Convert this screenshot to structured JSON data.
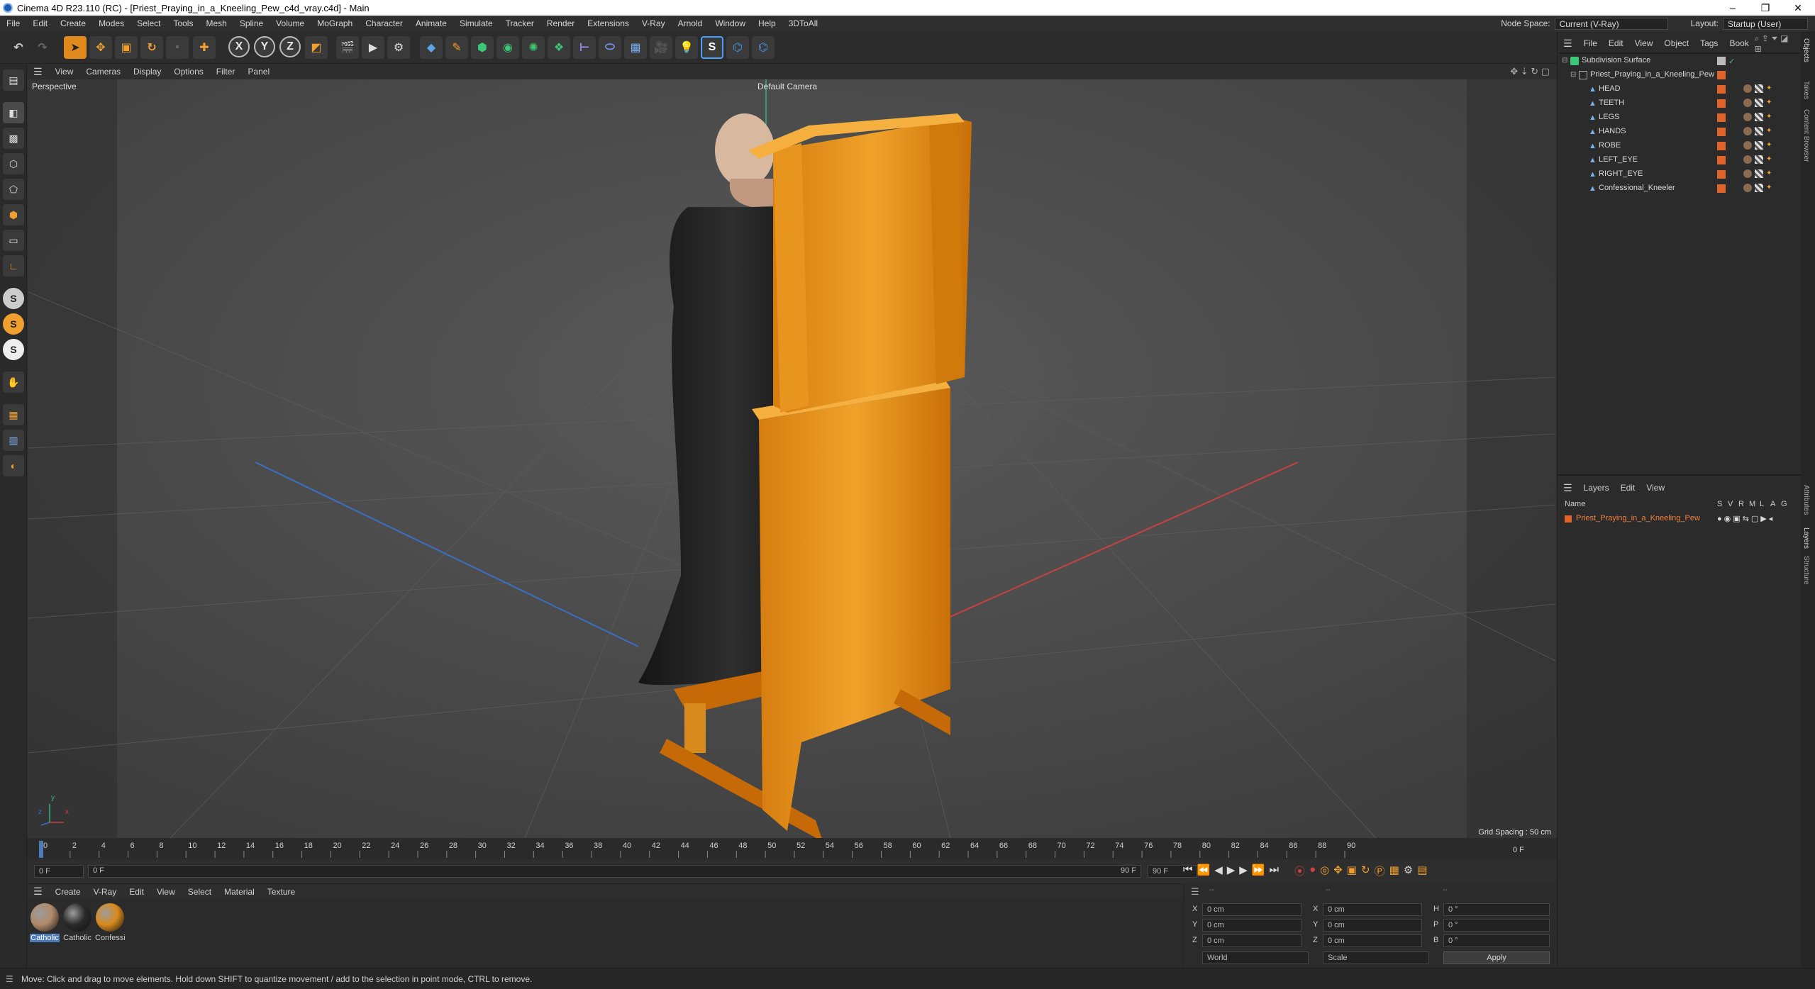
{
  "window": {
    "title": "Cinema 4D R23.110 (RC) - [Priest_Praying_in_a_Kneeling_Pew_c4d_vray.c4d] - Main",
    "controls": [
      "–",
      "❐",
      "✕"
    ]
  },
  "menubar": {
    "items": [
      "File",
      "Edit",
      "Create",
      "Modes",
      "Select",
      "Tools",
      "Mesh",
      "Spline",
      "Volume",
      "MoGraph",
      "Character",
      "Animate",
      "Simulate",
      "Tracker",
      "Render",
      "Extensions",
      "V-Ray",
      "Arnold",
      "Window",
      "Help",
      "3DToAll"
    ],
    "node_space_label": "Node Space:",
    "node_space_value": "Current (V-Ray)",
    "layout_label": "Layout:",
    "layout_value": "Startup (User)"
  },
  "toolbar": {
    "axis_x": "X",
    "axis_y": "Y",
    "axis_z": "Z"
  },
  "left_tools": {
    "s_labels": [
      "S",
      "S",
      "S"
    ]
  },
  "viewport": {
    "menu": [
      "View",
      "Cameras",
      "Display",
      "Options",
      "Filter",
      "Panel"
    ],
    "view_name": "Perspective",
    "camera_name": "Default Camera",
    "grid_spacing": "Grid Spacing : 50 cm",
    "axis_y": "y",
    "axis_z": "z",
    "axis_x": "x"
  },
  "timeline": {
    "ticks": [
      "0",
      "2",
      "4",
      "6",
      "8",
      "10",
      "12",
      "14",
      "16",
      "18",
      "20",
      "22",
      "24",
      "26",
      "28",
      "30",
      "32",
      "34",
      "36",
      "38",
      "40",
      "42",
      "44",
      "46",
      "48",
      "50",
      "52",
      "54",
      "56",
      "58",
      "60",
      "62",
      "64",
      "66",
      "68",
      "70",
      "72",
      "74",
      "76",
      "78",
      "80",
      "82",
      "84",
      "86",
      "88",
      "90"
    ],
    "start_frame": "0 F",
    "current_frame": "0 F",
    "end_frame": "90 F",
    "end_frame2": "90 F",
    "frame_right": "0 F"
  },
  "material_manager": {
    "menu": [
      "Create",
      "V-Ray",
      "Edit",
      "View",
      "Select",
      "Material",
      "Texture"
    ],
    "materials": [
      {
        "name": "Catholic",
        "color": "#b08a6a",
        "selected": true
      },
      {
        "name": "Catholic",
        "color": "#2a2a2a",
        "selected": false
      },
      {
        "name": "Confessi",
        "color": "#d98a1c",
        "selected": false
      }
    ]
  },
  "coordinates": {
    "header_left": "--",
    "header_mid": "--",
    "header_right": "--",
    "rows": [
      {
        "a": "X",
        "av": "0 cm",
        "b": "X",
        "bv": "0 cm",
        "c": "H",
        "cv": "0 °"
      },
      {
        "a": "Y",
        "av": "0 cm",
        "b": "Y",
        "bv": "0 cm",
        "c": "P",
        "cv": "0 °"
      },
      {
        "a": "Z",
        "av": "0 cm",
        "b": "Z",
        "bv": "0 cm",
        "c": "B",
        "cv": "0 °"
      }
    ],
    "space": "World",
    "mode": "Scale",
    "apply": "Apply"
  },
  "status": {
    "text": "Move: Click and drag to move elements. Hold down SHIFT to quantize movement / add to the selection in point mode, CTRL to remove."
  },
  "object_manager": {
    "menu": [
      "File",
      "Edit",
      "View",
      "Object",
      "Tags",
      "Book"
    ],
    "objects": [
      {
        "name": "Subdivision Surface",
        "indent": 0
      },
      {
        "name": "Priest_Praying_in_a_Kneeling_Pew",
        "indent": 1
      },
      {
        "name": "HEAD",
        "indent": 2
      },
      {
        "name": "TEETH",
        "indent": 2
      },
      {
        "name": "LEGS",
        "indent": 2
      },
      {
        "name": "HANDS",
        "indent": 2
      },
      {
        "name": "ROBE",
        "indent": 2
      },
      {
        "name": "LEFT_EYE",
        "indent": 2
      },
      {
        "name": "RIGHT_EYE",
        "indent": 2
      },
      {
        "name": "Confessional_Kneeler",
        "indent": 2
      }
    ]
  },
  "layer_manager": {
    "menu": [
      "Layers",
      "Edit",
      "View"
    ],
    "col_name": "Name",
    "col_flags": [
      "S",
      "V",
      "R",
      "M",
      "L",
      "A",
      "G"
    ],
    "layers": [
      {
        "name": "Priest_Praying_in_a_Kneeling_Pew",
        "color": "#e0642a"
      }
    ]
  },
  "right_tabs": [
    "Objects",
    "Takes",
    "Content Browser",
    "Attributes",
    "Layers",
    "Structure"
  ],
  "colors": {
    "accent_orange": "#e0642a",
    "selection_blue": "#4d7ab8",
    "axis_x": "#c94040",
    "axis_z": "#3a6fc4",
    "axis_y": "#35b080"
  }
}
